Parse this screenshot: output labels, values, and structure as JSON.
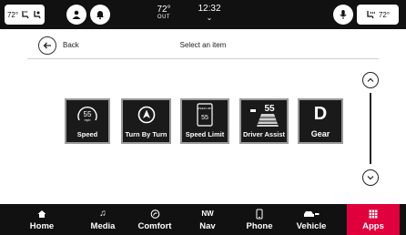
{
  "status": {
    "left_seat": "72°",
    "outside_temp": "72°",
    "outside_label": "OUT",
    "time": "12:32",
    "right_seat": "72°"
  },
  "header": {
    "back_label": "Back",
    "title": "Select an item"
  },
  "items": [
    {
      "label": "Speed",
      "value": "55",
      "unit": "mph"
    },
    {
      "label": "Turn By Turn"
    },
    {
      "label": "Speed Limit",
      "sign_top": "SPEED LIMIT",
      "sign_value": "55"
    },
    {
      "label": "Driver Assist",
      "value": "55"
    },
    {
      "label": "Gear",
      "value": "D"
    }
  ],
  "nav": {
    "home": "Home",
    "media": "Media",
    "comfort": "Comfort",
    "nav_top": "NW",
    "nav": "Nav",
    "phone": "Phone",
    "vehicle": "Vehicle",
    "apps": "Apps"
  },
  "colors": {
    "bar": "#111111",
    "active": "#e0003c"
  }
}
